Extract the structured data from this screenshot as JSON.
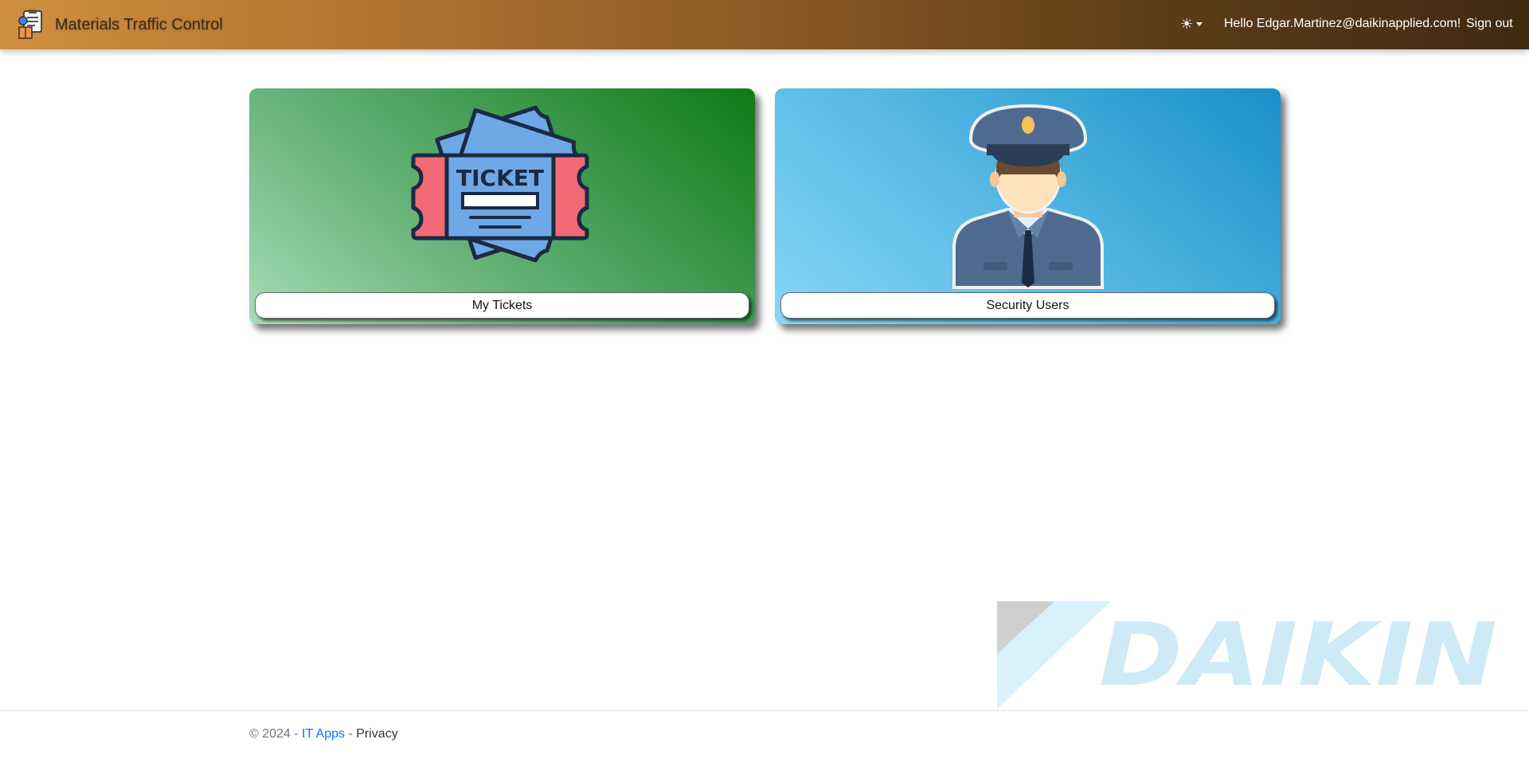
{
  "app": {
    "title": "Materials Traffic Control",
    "icon": "clipboard-box-icon"
  },
  "header": {
    "theme_toggle_icon": "sun-icon",
    "greeting": "Hello Edgar.Martinez@daikinapplied.com!",
    "signout_label": "Sign out",
    "gradient_colors": [
      "#d08e40",
      "#3f2a12"
    ]
  },
  "cards": [
    {
      "label": "My Tickets",
      "icon": "ticket-icon",
      "colors": [
        "#a8dcb8",
        "#0f7a15"
      ]
    },
    {
      "label": "Security Users",
      "icon": "security-guard-icon",
      "colors": [
        "#86d6f6",
        "#1a8fc8"
      ]
    }
  ],
  "watermark": {
    "text": "DAIKIN"
  },
  "footer": {
    "copyright": "© 2024 - ",
    "it_apps": "IT Apps",
    "separator": " - ",
    "privacy": "Privacy"
  }
}
